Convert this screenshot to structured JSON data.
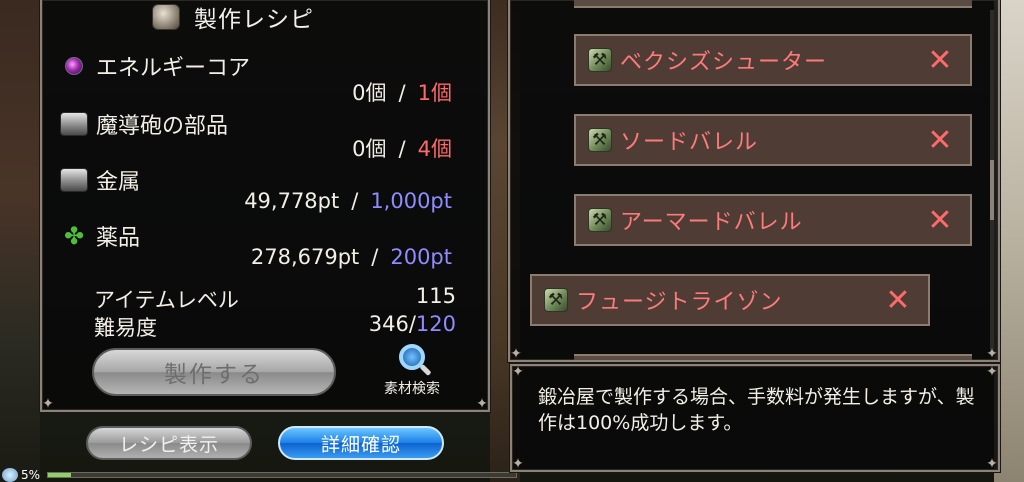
{
  "header": {
    "title": "製作レシピ",
    "icon": "recipe-book-icon"
  },
  "materials": [
    {
      "name": "エネルギーコア",
      "icon": "energy-core-icon",
      "have": "0個",
      "sep": "/",
      "need": "1個",
      "need_color": "red"
    },
    {
      "name": "魔導砲の部品",
      "icon": "parts-box-icon",
      "have": "0個",
      "sep": "/",
      "need": "4個",
      "need_color": "red"
    },
    {
      "name": "金属",
      "icon": "metal-box-icon",
      "have": "49,778pt",
      "sep": "/",
      "need": "1,000pt",
      "need_color": "blue"
    },
    {
      "name": "薬品",
      "icon": "herb-icon",
      "have": "278,679pt",
      "sep": "/",
      "need": "200pt",
      "need_color": "blue"
    }
  ],
  "stats": {
    "item_level_label": "アイテムレベル",
    "item_level_value": "115",
    "difficulty_label": "難易度",
    "difficulty_current": "346/",
    "difficulty_target": "120"
  },
  "buttons": {
    "craft": "製作する",
    "material_search": "素材検索",
    "recipe_view": "レシピ表示",
    "details": "詳細確認"
  },
  "progress": {
    "label": "5%",
    "value": 0.05
  },
  "recipe_list": [
    {
      "name": "ベクシズシューター",
      "remove": "✕"
    },
    {
      "name": "ソードバレル",
      "remove": "✕"
    },
    {
      "name": "アーマードバレル",
      "remove": "✕"
    },
    {
      "name": "フュージトライゾン",
      "remove": "✕"
    }
  ],
  "message": "鍛冶屋で製作する場合、手数料が発生しますが、製作は100%成功します。",
  "colors": {
    "need_red": "#ff6a6a",
    "need_blue": "#8f8cff",
    "recipe_text": "#ff7a7a",
    "detail_button": "#1a7fe8"
  }
}
